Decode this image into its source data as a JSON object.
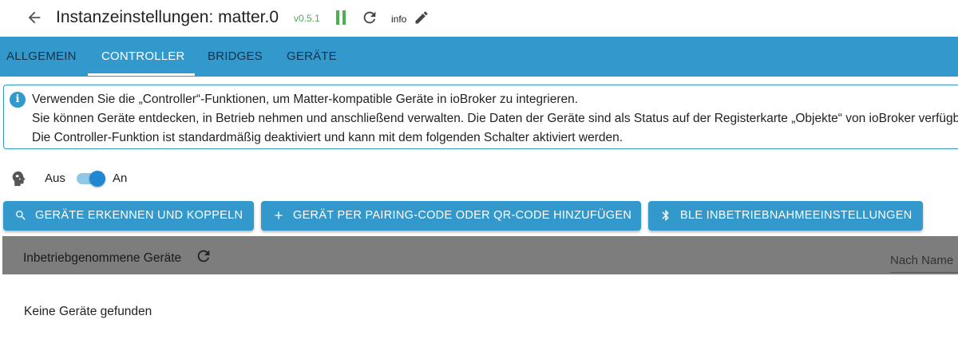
{
  "header": {
    "title": "Instanzeinstellungen: matter.0",
    "version": "v0.5.1",
    "info_label": "info"
  },
  "tabs": [
    {
      "label": "ALLGEMEIN",
      "active": false
    },
    {
      "label": "CONTROLLER",
      "active": true
    },
    {
      "label": "BRIDGES",
      "active": false
    },
    {
      "label": "GERÄTE",
      "active": false
    }
  ],
  "info": {
    "icon": "info-icon",
    "lines": [
      "Verwenden Sie die „Controller“-Funktionen, um Matter-kompatible Geräte in ioBroker zu integrieren.",
      "Sie können Geräte entdecken, in Betrieb nehmen und anschließend verwalten. Die Daten der Geräte sind als Status auf der Registerkarte „Objekte“ von ioBroker verfügbar.",
      "Die Controller-Funktion ist standardmäßig deaktiviert und kann mit dem folgenden Schalter aktiviert werden."
    ]
  },
  "controller_toggle": {
    "off_label": "Aus",
    "on_label": "An",
    "checked": true
  },
  "actions": [
    {
      "label": "GERÄTE ERKENNEN UND KOPPELN",
      "icon": "search-icon"
    },
    {
      "label": "GERÄT PER PAIRING-CODE ODER QR-CODE HINZUFÜGEN",
      "icon": "plus-icon"
    },
    {
      "label": "BLE INBETRIEBNAHMEEINSTELLUNGEN",
      "icon": "bluetooth-icon"
    }
  ],
  "devices": {
    "title": "Inbetriebgenommene Geräte",
    "sort_placeholder": "Nach Name",
    "empty_text": "Keine Geräte gefunden"
  },
  "colors": {
    "accent": "#3399cc",
    "running": "#4caf50",
    "grid_header": "#7d7d7d"
  }
}
